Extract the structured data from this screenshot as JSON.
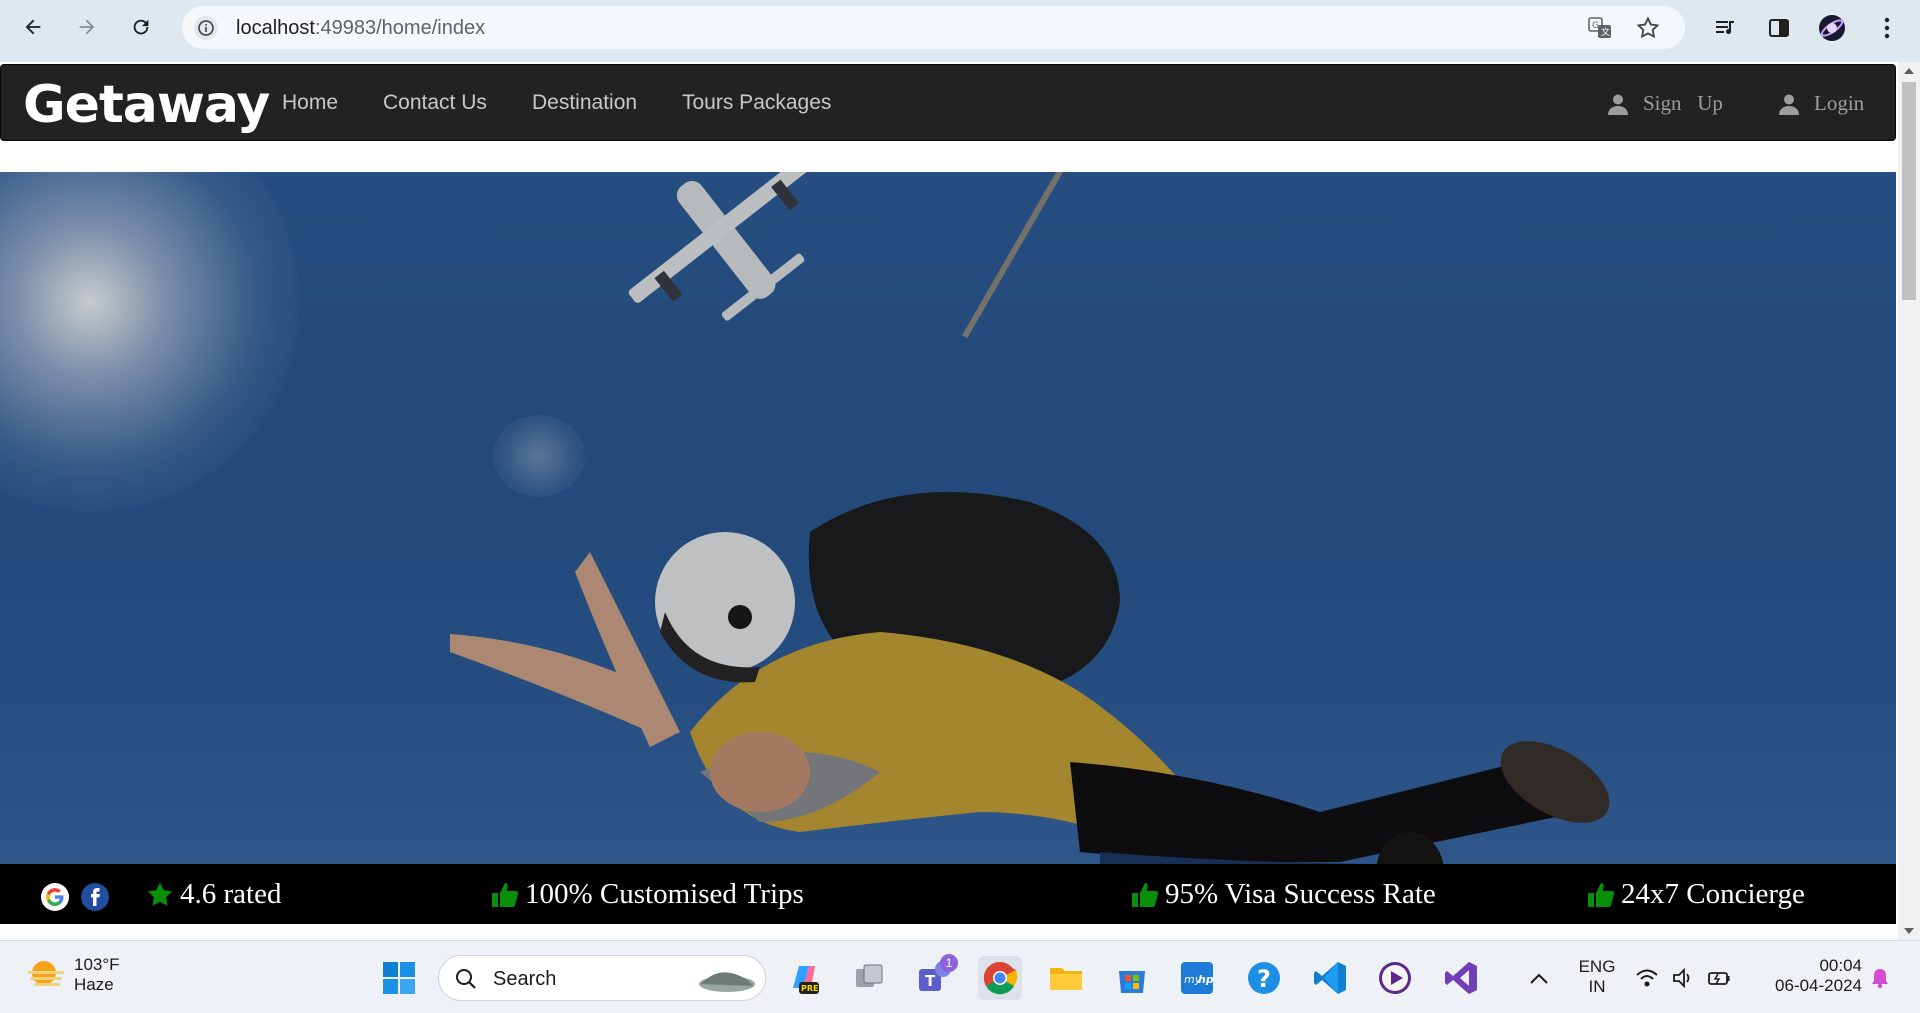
{
  "browser": {
    "url_host": "localhost",
    "url_path": ":49983/home/index",
    "icons": [
      "back-arrow-icon",
      "forward-arrow-icon",
      "reload-icon",
      "site-info-icon",
      "translate-icon",
      "bookmark-star-icon",
      "media-icon",
      "side-panel-icon",
      "profile-avatar-icon",
      "kebab-menu-icon"
    ]
  },
  "site": {
    "brand": "Getaway",
    "nav": {
      "home": "Home",
      "contact": "Contact Us",
      "destination": "Destination",
      "tours": "Tours Packages",
      "signup": "Sign   Up",
      "login": "Login"
    },
    "hero_alt": "Tandem skydivers in free fall beneath an airplane",
    "features": {
      "rating": "4.6 rated",
      "customised": "100% Customised Trips",
      "visa": "95% Visa Success Rate",
      "concierge": "24x7 Concierge"
    },
    "colors": {
      "navbar": "#222222",
      "nav_link": "#c8c8c8",
      "strip": "#000000",
      "feature_icon": "#0a8f0a"
    }
  },
  "taskbar": {
    "weather_temp": "103°F",
    "weather_cond": "Haze",
    "search_label": "Search",
    "teams_badge": "1",
    "lang_top": "ENG",
    "lang_bottom": "IN",
    "time": "00:04",
    "date": "06-04-2024"
  }
}
